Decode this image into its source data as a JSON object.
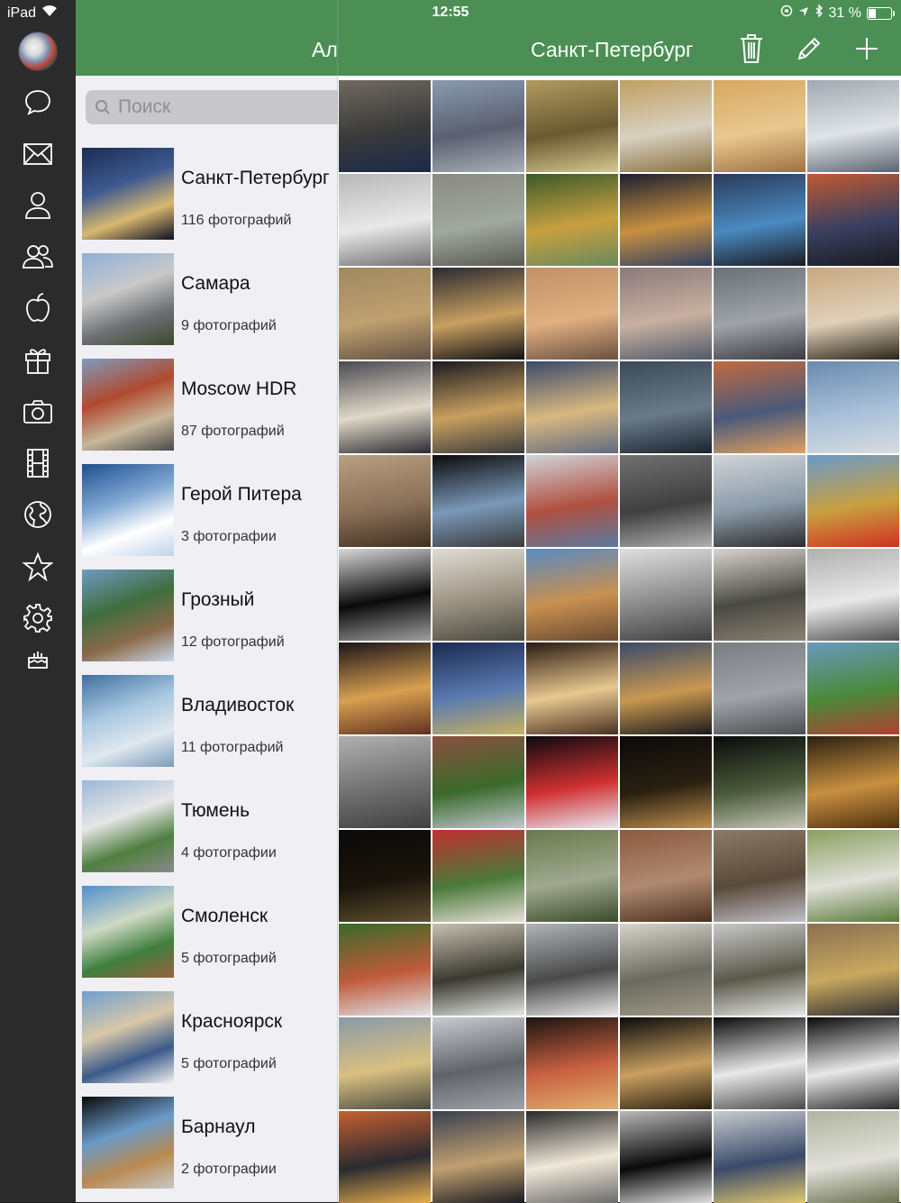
{
  "status_bar": {
    "device": "iPad",
    "time": "12:55",
    "battery": "31 %"
  },
  "rail": {
    "icons": [
      "avatar",
      "chat-bubble-icon",
      "mail-icon",
      "person-icon",
      "people-icon",
      "apple-icon",
      "gift-icon",
      "camera-icon",
      "film-icon",
      "globe-icon",
      "star-icon",
      "gear-icon",
      "cake-icon"
    ]
  },
  "sidebar": {
    "title": "Альбомы",
    "search": {
      "placeholder": "Поиск"
    },
    "albums": [
      {
        "name": "Санкт-Петербург",
        "count": "116 фотографий",
        "colors": [
          "#1d2b52",
          "#3d5a90",
          "#d8b870",
          "#0b1020"
        ]
      },
      {
        "name": "Самара",
        "count": "9 фотографий",
        "colors": [
          "#8fb0d8",
          "#c9c9c9",
          "#6d6f72",
          "#3a4a2a"
        ]
      },
      {
        "name": "Moscow HDR",
        "count": "87 фотографий",
        "colors": [
          "#7e9bc0",
          "#b04a2e",
          "#c8b89a",
          "#4a4a4a"
        ]
      },
      {
        "name": "Герой Питера",
        "count": "3 фотографии",
        "colors": [
          "#1d4f8f",
          "#7fa7d2",
          "#ffffff",
          "#c0d4ea"
        ]
      },
      {
        "name": "Грозный",
        "count": "12 фотографий",
        "colors": [
          "#6f9ac2",
          "#3f6e3f",
          "#8a6a4a",
          "#c8d8e8"
        ]
      },
      {
        "name": "Владивосток",
        "count": "11 фотографий",
        "colors": [
          "#3f6f9f",
          "#a8c8e0",
          "#dfe8ef",
          "#7a9ab8"
        ]
      },
      {
        "name": "Тюмень",
        "count": "4 фотографии",
        "colors": [
          "#9ab8d8",
          "#e6e6e6",
          "#4f7f3f",
          "#8a8a8a"
        ]
      },
      {
        "name": "Смоленск",
        "count": "5 фотографий",
        "colors": [
          "#4f8fd0",
          "#cfd9c4",
          "#3f7f3f",
          "#9a6040"
        ]
      },
      {
        "name": "Красноярск",
        "count": "5 фотографий",
        "colors": [
          "#6f9fd0",
          "#d8c8a8",
          "#3a5a8a",
          "#f0f0f0"
        ]
      },
      {
        "name": "Барнаул",
        "count": "2 фотографии",
        "colors": [
          "#0a0a0a",
          "#6a9ac8",
          "#b88a50",
          "#c8c8c8"
        ]
      }
    ]
  },
  "gallery": {
    "title": "Санкт-Петербург",
    "actions": [
      "trash-icon",
      "pencil-icon",
      "plus-icon"
    ],
    "photos": [
      [
        "#6f6a60",
        "#3a3a3a",
        "#1a2a4a"
      ],
      [
        "#8a9ab0",
        "#5a6070",
        "#a8b0b8"
      ],
      [
        "#b09a60",
        "#6a5a30",
        "#d8c890"
      ],
      [
        "#c0a060",
        "#d8d0c0",
        "#8a7040"
      ],
      [
        "#d8a860",
        "#e8c890",
        "#a07040"
      ],
      [
        "#a0a8b0",
        "#e0e4e8",
        "#5a6470"
      ],
      [
        "#b8b8b8",
        "#e8e8e8",
        "#707070"
      ],
      [
        "#8a8a80",
        "#a0a8a0",
        "#5a5a50"
      ],
      [
        "#3a5a2a",
        "#c8a040",
        "#6a8a5a"
      ],
      [
        "#1a2030",
        "#c89040",
        "#304060"
      ],
      [
        "#2a3a5a",
        "#4a8ac0",
        "#1a1a20"
      ],
      [
        "#c05a30",
        "#3a4060",
        "#1a1a20"
      ],
      [
        "#a08860",
        "#c0a070",
        "#605040"
      ],
      [
        "#2a2a30",
        "#c8a060",
        "#101014"
      ],
      [
        "#c09068",
        "#e0b080",
        "#6a5040"
      ],
      [
        "#8a7a7a",
        "#c8b0a0",
        "#505a6a"
      ],
      [
        "#6a7078",
        "#a0a4a8",
        "#3a3a40"
      ],
      [
        "#c8a880",
        "#e0d0b8",
        "#2a2418"
      ],
      [
        "#4a4a50",
        "#e0d8c8",
        "#2a2a30"
      ],
      [
        "#1a1a20",
        "#c8a060",
        "#3a3a3a"
      ],
      [
        "#3a4a6a",
        "#d8b880",
        "#606a80"
      ],
      [
        "#3a4a58",
        "#6a7a88",
        "#1a2430"
      ],
      [
        "#c06a40",
        "#4a5a7a",
        "#e0a060"
      ],
      [
        "#6a8ab0",
        "#a8c0d8",
        "#d8dce0"
      ],
      [
        "#b8a080",
        "#8a7058",
        "#403020"
      ],
      [
        "#0a0a0a",
        "#7a98b8",
        "#3a3a3a"
      ],
      [
        "#d0d4d8",
        "#b05040",
        "#5a7aa0"
      ],
      [
        "#707070",
        "#404040",
        "#b0b0b0"
      ],
      [
        "#d0d4d8",
        "#8a9aa8",
        "#2a2a2a"
      ],
      [
        "#6a9ac8",
        "#c8a040",
        "#d03020"
      ],
      [
        "#d8d8d8",
        "#0a0a0a",
        "#a0a0a0"
      ],
      [
        "#e0dcd4",
        "#9a9080",
        "#4a4a40"
      ],
      [
        "#5a8ac0",
        "#c89050",
        "#6a4a30"
      ],
      [
        "#e0e0e0",
        "#8a8a8a",
        "#404040"
      ],
      [
        "#d8d4cc",
        "#4a4a44",
        "#8a8070"
      ],
      [
        "#b0b0b0",
        "#e8e8e8",
        "#505050"
      ],
      [
        "#1a1418",
        "#d8a050",
        "#603020"
      ],
      [
        "#1a2a50",
        "#5a7ab0",
        "#c8b060"
      ],
      [
        "#2a1a10",
        "#e8c890",
        "#4a3020"
      ],
      [
        "#3a4a6a",
        "#c89850",
        "#1a1a1a"
      ],
      [
        "#7a7e82",
        "#a0a4a8",
        "#4a4e52"
      ],
      [
        "#6a98c0",
        "#4a8a3a",
        "#b04030"
      ],
      [
        "#b0b0b0",
        "#707070",
        "#404040"
      ],
      [
        "#8a5040",
        "#3a6a2a",
        "#c0c8d0"
      ],
      [
        "#0a0a10",
        "#d03030",
        "#e8e8f0"
      ],
      [
        "#0a0a0a",
        "#2a2010",
        "#c09050"
      ],
      [
        "#0a0a0a",
        "#4a5a3a",
        "#c8c8b8"
      ],
      [
        "#2a2010",
        "#c89040",
        "#503010"
      ],
      [
        "#0a0a0a",
        "#1a140a",
        "#605030"
      ],
      [
        "#c03030",
        "#4a7a3a",
        "#e8e0d8"
      ],
      [
        "#6a7a4a",
        "#a0a890",
        "#3a4a2a"
      ],
      [
        "#8a5a40",
        "#b08a70",
        "#4a3020"
      ],
      [
        "#8a7a6a",
        "#5a4a3a",
        "#c0c0c8"
      ],
      [
        "#8aa060",
        "#e0e0d8",
        "#5a7a3a"
      ],
      [
        "#3a6a2a",
        "#c05a3a",
        "#e0e4e8"
      ],
      [
        "#c8c0b0",
        "#3a3a30",
        "#e8e8e8"
      ],
      [
        "#b0b4b8",
        "#4a4a4a",
        "#e8e8e8"
      ],
      [
        "#d8d4cc",
        "#6a6a60",
        "#a09a88"
      ],
      [
        "#c8c8c8",
        "#5a5a4a",
        "#e8e8e8"
      ],
      [
        "#8a7050",
        "#c8a860",
        "#303030"
      ],
      [
        "#8a9aa8",
        "#d8c080",
        "#4a4a40"
      ],
      [
        "#c8ccd0",
        "#606468",
        "#a0a4a8"
      ],
      [
        "#1a1410",
        "#c86040",
        "#e0b070"
      ],
      [
        "#0a0a0a",
        "#c8a060",
        "#2a2010"
      ],
      [
        "#0a0a0a",
        "#e8e8e8",
        "#4a4a4a"
      ],
      [
        "#0a0a0a",
        "#e8e8e8",
        "#2a2a2a"
      ],
      [
        "#c86030",
        "#2a2a30",
        "#e8b050"
      ],
      [
        "#3a4050",
        "#c0a070",
        "#1a1a20"
      ],
      [
        "#2a2a2a",
        "#f0e8d8",
        "#6a6a6a"
      ],
      [
        "#b8b8b8",
        "#0a0a0a",
        "#e0e0e0"
      ],
      [
        "#c8ccd0",
        "#3a4a6a",
        "#e0c870"
      ],
      [
        "#b0b4a0",
        "#e0e0d8",
        "#6a7050"
      ]
    ]
  }
}
